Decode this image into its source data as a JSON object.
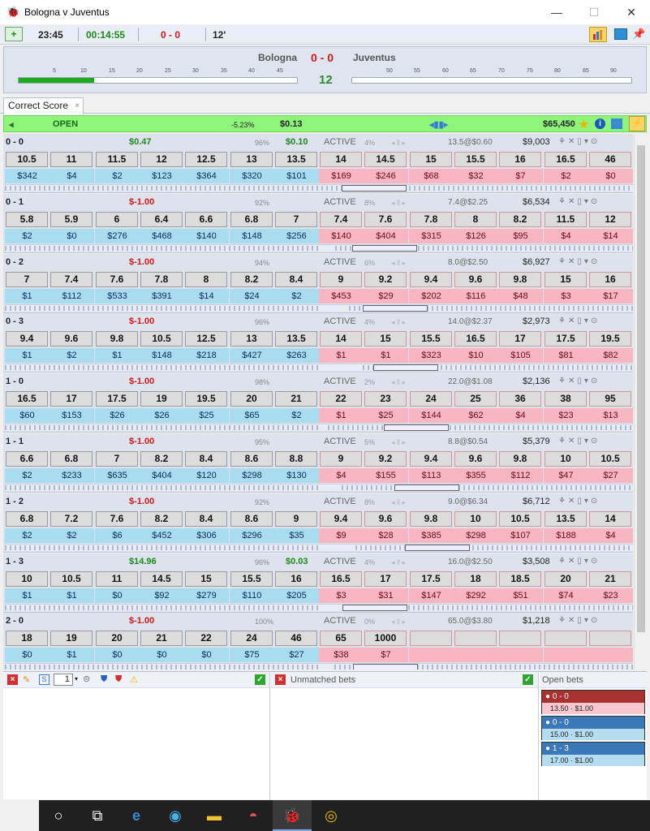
{
  "window": {
    "title": "Bologna v Juventus",
    "app_icon": "beetle-icon",
    "btn_min": "—",
    "btn_max": "☐",
    "btn_close": "✕"
  },
  "toolbar": {
    "time": "23:45",
    "elapsed": "00:14:55",
    "score": "0 - 0",
    "minute": "12'",
    "icons": [
      "add-market-icon",
      "chart-icon",
      "screen-icon",
      "pin-icon"
    ]
  },
  "scoreboard": {
    "home": "Bologna",
    "away": "Juventus",
    "score": "0 - 0",
    "minute": "12",
    "first_half_progress": 0.27,
    "second_half_progress": 0.0,
    "ticks_first": [
      "5",
      "10",
      "15",
      "20",
      "25",
      "30",
      "35",
      "40",
      "45"
    ],
    "ticks_second": [
      "50",
      "55",
      "60",
      "65",
      "70",
      "75",
      "80",
      "85",
      "90"
    ]
  },
  "tab": {
    "label": "Correct Score",
    "close": "×"
  },
  "market_status": {
    "state": "OPEN",
    "pct": "-5.23%",
    "pl": "$0.13",
    "matched": "$65,450"
  },
  "markets": [
    {
      "name": "0 - 0",
      "pl": "$0.47",
      "pl_sign": "pos",
      "pct": "96%",
      "pl2": "$0.10",
      "status": "ACTIVE",
      "pct2": "4%",
      "ltd": "13.5@$0.60",
      "matched": "$9,003",
      "back": [
        "10.5",
        "11",
        "11.5",
        "12",
        "12.5",
        "13",
        "13.5"
      ],
      "lay": [
        "14",
        "14.5",
        "15",
        "15.5",
        "16",
        "16.5",
        "46"
      ],
      "back_stake": [
        "$342",
        "$4",
        "$2",
        "$123",
        "$364",
        "$320",
        "$101"
      ],
      "lay_stake": [
        "$169",
        "$246",
        "$68",
        "$32",
        "$7",
        "$2",
        "$0"
      ]
    },
    {
      "name": "0 - 1",
      "pl": "$-1.00",
      "pl_sign": "neg",
      "pct": "92%",
      "pl2": "",
      "status": "ACTIVE",
      "pct2": "8%",
      "ltd": "7.4@$2.25",
      "matched": "$6,534",
      "back": [
        "5.8",
        "5.9",
        "6",
        "6.4",
        "6.6",
        "6.8",
        "7"
      ],
      "lay": [
        "7.4",
        "7.6",
        "7.8",
        "8",
        "8.2",
        "11.5",
        "12"
      ],
      "back_stake": [
        "$2",
        "$0",
        "$276",
        "$468",
        "$140",
        "$148",
        "$256"
      ],
      "lay_stake": [
        "$140",
        "$404",
        "$315",
        "$126",
        "$95",
        "$4",
        "$14"
      ]
    },
    {
      "name": "0 - 2",
      "pl": "$-1.00",
      "pl_sign": "neg",
      "pct": "94%",
      "pl2": "",
      "status": "ACTIVE",
      "pct2": "6%",
      "ltd": "8.0@$2.50",
      "matched": "$6,927",
      "back": [
        "7",
        "7.4",
        "7.6",
        "7.8",
        "8",
        "8.2",
        "8.4"
      ],
      "lay": [
        "9",
        "9.2",
        "9.4",
        "9.6",
        "9.8",
        "15",
        "16"
      ],
      "back_stake": [
        "$1",
        "$112",
        "$533",
        "$391",
        "$14",
        "$24",
        "$2"
      ],
      "lay_stake": [
        "$453",
        "$29",
        "$202",
        "$116",
        "$48",
        "$3",
        "$17"
      ]
    },
    {
      "name": "0 - 3",
      "pl": "$-1.00",
      "pl_sign": "neg",
      "pct": "96%",
      "pl2": "",
      "status": "ACTIVE",
      "pct2": "4%",
      "ltd": "14.0@$2.37",
      "matched": "$2,973",
      "back": [
        "9.4",
        "9.6",
        "9.8",
        "10.5",
        "12.5",
        "13",
        "13.5"
      ],
      "lay": [
        "14",
        "15",
        "15.5",
        "16.5",
        "17",
        "17.5",
        "19.5"
      ],
      "back_stake": [
        "$1",
        "$2",
        "$1",
        "$148",
        "$218",
        "$427",
        "$263"
      ],
      "lay_stake": [
        "$1",
        "$1",
        "$323",
        "$10",
        "$105",
        "$81",
        "$82"
      ]
    },
    {
      "name": "1 - 0",
      "pl": "$-1.00",
      "pl_sign": "neg",
      "pct": "98%",
      "pl2": "",
      "status": "ACTIVE",
      "pct2": "2%",
      "ltd": "22.0@$1.08",
      "matched": "$2,136",
      "back": [
        "16.5",
        "17",
        "17.5",
        "19",
        "19.5",
        "20",
        "21"
      ],
      "lay": [
        "22",
        "23",
        "24",
        "25",
        "36",
        "38",
        "95"
      ],
      "back_stake": [
        "$60",
        "$153",
        "$26",
        "$26",
        "$25",
        "$65",
        "$2"
      ],
      "lay_stake": [
        "$1",
        "$25",
        "$144",
        "$62",
        "$4",
        "$23",
        "$13"
      ]
    },
    {
      "name": "1 - 1",
      "pl": "$-1.00",
      "pl_sign": "neg",
      "pct": "95%",
      "pl2": "",
      "status": "ACTIVE",
      "pct2": "5%",
      "ltd": "8.8@$0.54",
      "matched": "$5,379",
      "back": [
        "6.6",
        "6.8",
        "7",
        "8.2",
        "8.4",
        "8.6",
        "8.8"
      ],
      "lay": [
        "9",
        "9.2",
        "9.4",
        "9.6",
        "9.8",
        "10",
        "10.5"
      ],
      "back_stake": [
        "$2",
        "$233",
        "$635",
        "$404",
        "$120",
        "$298",
        "$130"
      ],
      "lay_stake": [
        "$4",
        "$155",
        "$113",
        "$355",
        "$112",
        "$47",
        "$27"
      ]
    },
    {
      "name": "1 - 2",
      "pl": "$-1.00",
      "pl_sign": "neg",
      "pct": "92%",
      "pl2": "",
      "status": "ACTIVE",
      "pct2": "8%",
      "ltd": "9.0@$6.34",
      "matched": "$6,712",
      "back": [
        "6.8",
        "7.2",
        "7.6",
        "8.2",
        "8.4",
        "8.6",
        "9"
      ],
      "lay": [
        "9.4",
        "9.6",
        "9.8",
        "10",
        "10.5",
        "13.5",
        "14"
      ],
      "back_stake": [
        "$2",
        "$2",
        "$6",
        "$452",
        "$306",
        "$296",
        "$35"
      ],
      "lay_stake": [
        "$9",
        "$28",
        "$385",
        "$298",
        "$107",
        "$188",
        "$4"
      ]
    },
    {
      "name": "1 - 3",
      "pl": "$14.96",
      "pl_sign": "pos",
      "pct": "96%",
      "pl2": "$0.03",
      "status": "ACTIVE",
      "pct2": "4%",
      "ltd": "16.0@$2.50",
      "matched": "$3,508",
      "back": [
        "10",
        "10.5",
        "11",
        "14.5",
        "15",
        "15.5",
        "16"
      ],
      "lay": [
        "16.5",
        "17",
        "17.5",
        "18",
        "18.5",
        "20",
        "21"
      ],
      "back_stake": [
        "$1",
        "$1",
        "$0",
        "$92",
        "$279",
        "$110",
        "$205"
      ],
      "lay_stake": [
        "$3",
        "$31",
        "$147",
        "$292",
        "$51",
        "$74",
        "$23"
      ]
    },
    {
      "name": "2 - 0",
      "pl": "$-1.00",
      "pl_sign": "neg",
      "pct": "100%",
      "pl2": "",
      "status": "ACTIVE",
      "pct2": "0%",
      "ltd": "65.0@$3.80",
      "matched": "$1,218",
      "back": [
        "18",
        "19",
        "20",
        "21",
        "22",
        "24",
        "46"
      ],
      "lay": [
        "65",
        "1000",
        "",
        "",
        "",
        "",
        ""
      ],
      "back_stake": [
        "$0",
        "$1",
        "$0",
        "$0",
        "$0",
        "$75",
        "$27"
      ],
      "lay_stake": [
        "$38",
        "$7",
        "",
        "",
        "",
        "",
        ""
      ]
    }
  ],
  "bottom": {
    "stake_value": "1",
    "unmatched_title": "Unmatched bets",
    "open_title": "Open bets",
    "open_bets": [
      {
        "sel": "0 - 0",
        "odds": "13.50",
        "stake": "$1.00",
        "color": "#a83232",
        "bg": "#f8c6cf"
      },
      {
        "sel": "0 - 0",
        "odds": "15.00",
        "stake": "$1.00",
        "color": "#3a78b8",
        "bg": "#b5dcef"
      },
      {
        "sel": "1 - 3",
        "odds": "17.00",
        "stake": "$1.00",
        "color": "#3a78b8",
        "bg": "#b5dcef"
      }
    ]
  },
  "taskbar": {
    "items": [
      "cortana-icon",
      "task-view-icon",
      "edge-icon",
      "browser-icon",
      "explorer-icon",
      "app-icon",
      "beetle-icon",
      "chrome-icon"
    ]
  }
}
